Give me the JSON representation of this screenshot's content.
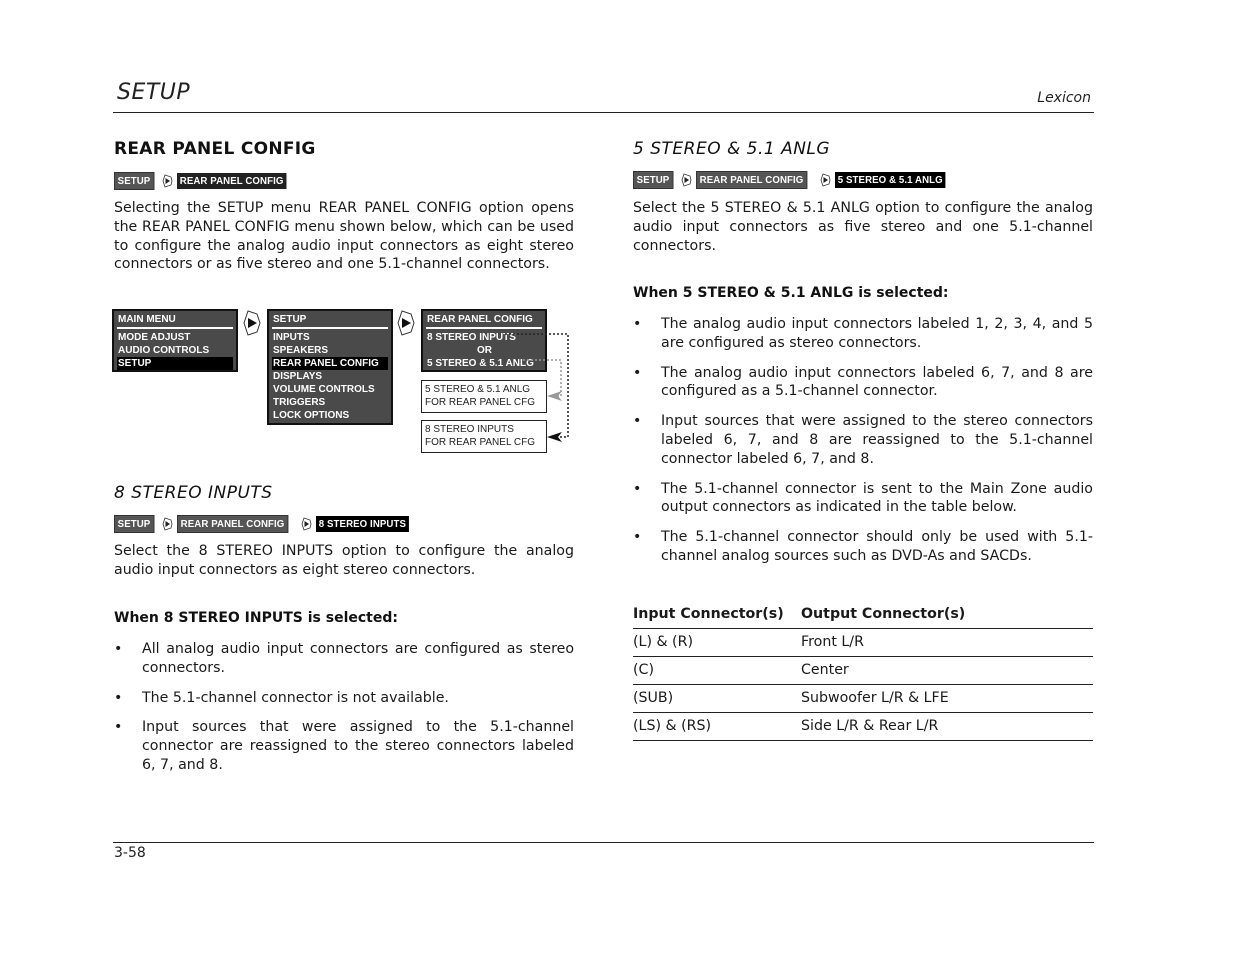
{
  "header": {
    "title": "SETUP",
    "brand": "Lexicon"
  },
  "footer": {
    "page_number": "3-58"
  },
  "left": {
    "rear_panel": {
      "heading": "REAR PANEL CONFIG",
      "breadcrumb": [
        "SETUP",
        "REAR PANEL CONFIG"
      ],
      "body": "Selecting the SETUP menu REAR PANEL CONFIG option opens the REAR PANEL CONFIG menu shown below, which can be used to configure the analog audio input connectors as eight stereo connectors or as five stereo and one 5.1-channel connectors."
    },
    "diagram": {
      "main_menu": {
        "title": "MAIN MENU",
        "items": [
          "MODE ADJUST",
          "AUDIO CONTROLS",
          "SETUP"
        ],
        "selected": "SETUP"
      },
      "setup_menu": {
        "title": "SETUP",
        "items": [
          "INPUTS",
          "SPEAKERS",
          "REAR PANEL CONFIG",
          "DISPLAYS",
          "VOLUME CONTROLS",
          "TRIGGERS",
          "LOCK OPTIONS"
        ],
        "selected": "REAR PANEL CONFIG"
      },
      "rear_panel_menu": {
        "title": "REAR PANEL CONFIG",
        "items": [
          "8 STEREO INPUTS",
          "OR",
          "5 STEREO & 5.1 ANLG"
        ]
      },
      "message_5_1": {
        "line1": "5 STEREO & 5.1 ANLG",
        "line2": "FOR REAR PANEL CFG"
      },
      "message_8": {
        "line1": "8 STEREO INPUTS",
        "line2": "FOR REAR PANEL CFG"
      },
      "arrow_icon": "select-arrow-icon"
    },
    "eight_stereo": {
      "heading": "8 STEREO INPUTS",
      "breadcrumb": [
        "SETUP",
        "REAR PANEL CONFIG",
        "8 STEREO INPUTS"
      ],
      "body": "Select the 8 STEREO INPUTS option to configure the analog audio input connectors as eight stereo connectors.",
      "subheading": "When 8 STEREO INPUTS is selected:",
      "bullets": [
        "All analog audio input connectors are configured as stereo connectors.",
        "The 5.1-channel connector is not available.",
        "Input sources that were assigned to the 5.1-channel connector are reassigned to the stereo connectors labeled 6, 7, and 8."
      ]
    }
  },
  "right": {
    "five_stereo": {
      "heading": "5 STEREO & 5.1 ANLG",
      "breadcrumb": [
        "SETUP",
        "REAR PANEL CONFIG",
        "5 STEREO & 5.1 ANLG"
      ],
      "body": "Select the 5 STEREO & 5.1 ANLG option to configure the analog audio input connectors as five stereo and one 5.1-channel connectors.",
      "subheading": "When 5 STEREO & 5.1 ANLG is selected:",
      "bullets": [
        "The analog audio input connectors labeled 1, 2, 3, 4, and 5 are configured as stereo connectors.",
        "The analog audio input connectors labeled 6, 7, and 8 are configured as a 5.1-channel connector.",
        "Input sources that were assigned to the stereo connectors labeled 6, 7, and 8 are reassigned to the 5.1-channel connector labeled 6, 7, and 8.",
        "The 5.1-channel connector is sent to the Main Zone audio output connectors as indicated in the table below.",
        "The 5.1-channel connector should only be used with 5.1-channel analog sources such as DVD-As and SACDs."
      ]
    },
    "table": {
      "headers": [
        "Input Connector(s)",
        "Output Connector(s)"
      ],
      "rows": [
        [
          "(L) & (R)",
          "Front L/R"
        ],
        [
          "(C)",
          "Center"
        ],
        [
          "(SUB)",
          "Subwoofer L/R & LFE"
        ],
        [
          "(LS) & (RS)",
          "Side L/R & Rear L/R"
        ]
      ]
    }
  },
  "bullet_glyph": "•"
}
